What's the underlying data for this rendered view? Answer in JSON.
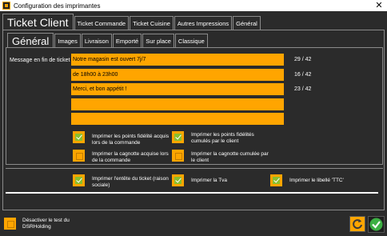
{
  "window": {
    "title": "Configuration des imprimantes",
    "close_glyph": "✕"
  },
  "top_tabs": {
    "active": "Ticket Client",
    "items": [
      "Ticket Commande",
      "Ticket Cuisine",
      "Autres Impressions",
      "Général"
    ]
  },
  "sub_tabs": {
    "active": "Général",
    "items": [
      "Images",
      "Livraison",
      "Emporté",
      "Sur place",
      "Classique"
    ]
  },
  "message": {
    "label": "Message en fin de ticket :",
    "lines": [
      {
        "value": "Notre magasin est ouvert 7j/7",
        "counter": "29 / 42"
      },
      {
        "value": "de 18h00 à 23h00",
        "counter": "16 / 42"
      },
      {
        "value": "Merci, et bon appétit !",
        "counter": "23 / 42"
      },
      {
        "value": "",
        "counter": ""
      },
      {
        "value": "",
        "counter": ""
      }
    ]
  },
  "options": {
    "points_commande": {
      "label": "Imprimer les points fidélité acquis lors de la commande",
      "checked": true
    },
    "points_cumules": {
      "label": "Imprimer les points fidélités cumulés par le client",
      "checked": true
    },
    "cagnotte_commande": {
      "label": "Imprimer la cagnotte acquise lors de la commande",
      "checked": false
    },
    "cagnotte_cumulee": {
      "label": "Imprimer la cagnotte cumulée par le client",
      "checked": false
    },
    "entete": {
      "label": "Imprimer l'entête du ticket (raison sociale)",
      "checked": true
    },
    "tva": {
      "label": "Imprimer la Tva",
      "checked": true
    },
    "ttc": {
      "label": "Imprimer le libellé 'TTC'",
      "checked": true
    }
  },
  "footer": {
    "test_label": "Désactiver le test du DSRHolding",
    "test_checked": false
  },
  "colors": {
    "accent": "#ffa500",
    "check_green": "#8abf2e",
    "background": "#2b2b2b"
  },
  "icons": {
    "refresh": "refresh-icon",
    "validate": "check-icon",
    "app": "app-logo-icon"
  }
}
